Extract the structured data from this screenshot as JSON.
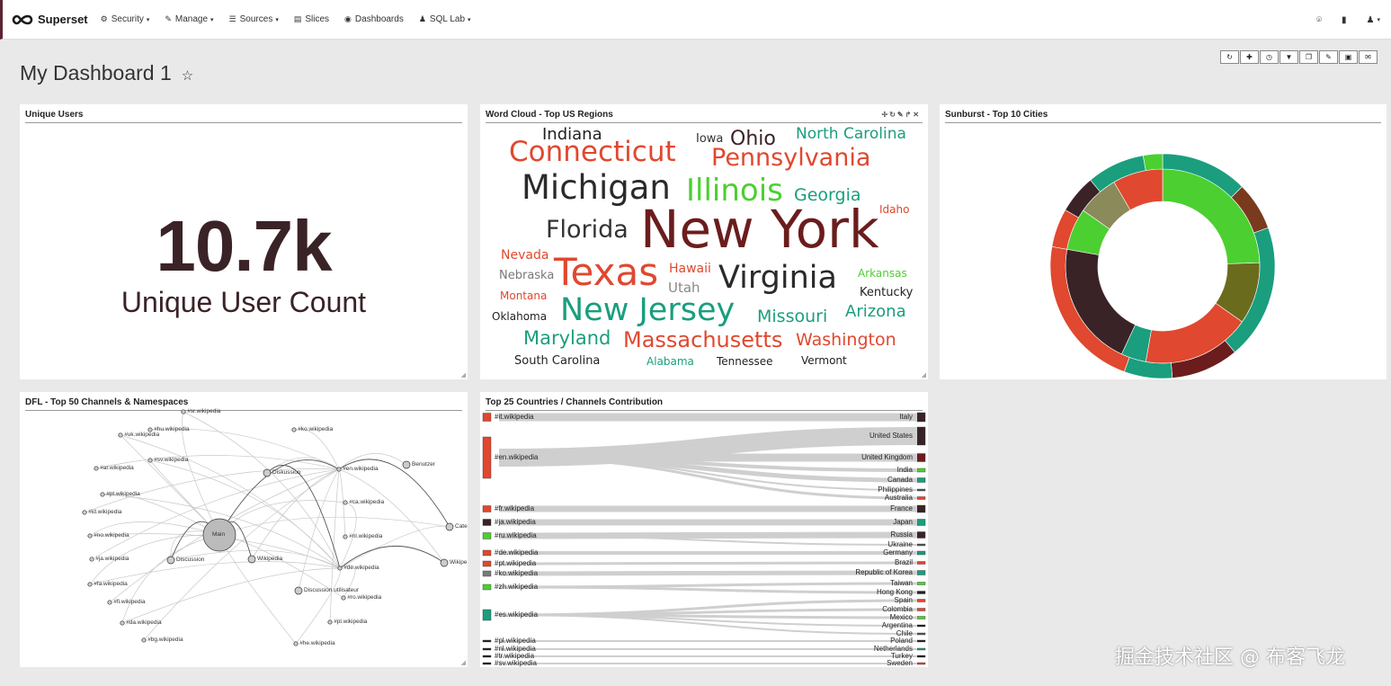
{
  "nav": {
    "brand": "Superset",
    "items": [
      {
        "id": "security",
        "icon": "⚙",
        "icon_name": "cogs-icon",
        "label": "Security",
        "dropdown": true
      },
      {
        "id": "manage",
        "icon": "✎",
        "icon_name": "wrench-icon",
        "label": "Manage",
        "dropdown": true
      },
      {
        "id": "sources",
        "icon": "☰",
        "icon_name": "database-icon",
        "label": "Sources",
        "dropdown": true
      },
      {
        "id": "slices",
        "icon": "▤",
        "icon_name": "bar-chart-icon",
        "label": "Slices",
        "dropdown": false
      },
      {
        "id": "dashboards",
        "icon": "◉",
        "icon_name": "dashboard-icon",
        "label": "Dashboards",
        "dropdown": false
      },
      {
        "id": "sqllab",
        "icon": "♟",
        "icon_name": "flask-icon",
        "label": "SQL Lab",
        "dropdown": true
      }
    ],
    "right_icons": [
      "github-icon",
      "book-icon",
      "user-icon"
    ]
  },
  "dashboard": {
    "title": "My Dashboard 1",
    "controls": [
      "refresh-icon",
      "add-slice-icon",
      "history-icon",
      "filter-icon",
      "css-icon",
      "edit-icon",
      "save-icon",
      "email-icon"
    ]
  },
  "panels": {
    "unique_users": {
      "title": "Unique Users",
      "value": "10.7k",
      "subheader": "Unique User Count"
    },
    "word_cloud": {
      "title": "Word Cloud - Top US Regions",
      "words": [
        {
          "text": "Indiana",
          "color": "#222222"
        },
        {
          "text": "Iowa",
          "color": "#333333"
        },
        {
          "text": "Ohio",
          "color": "#3a2326"
        },
        {
          "text": "North Carolina",
          "color": "#1a9e7e"
        },
        {
          "text": "Connecticut",
          "color": "#e0482f"
        },
        {
          "text": "Pennsylvania",
          "color": "#e0482f"
        },
        {
          "text": "Michigan",
          "color": "#2a2a2a"
        },
        {
          "text": "Illinois",
          "color": "#4ccf31"
        },
        {
          "text": "Georgia",
          "color": "#1a9e7e"
        },
        {
          "text": "Idaho",
          "color": "#e0482f"
        },
        {
          "text": "Florida",
          "color": "#333333"
        },
        {
          "text": "New York",
          "color": "#6b1d1d"
        },
        {
          "text": "Nevada",
          "color": "#e0482f"
        },
        {
          "text": "Texas",
          "color": "#e0482f"
        },
        {
          "text": "Hawaii",
          "color": "#e0482f"
        },
        {
          "text": "Virginia",
          "color": "#2a2a2a"
        },
        {
          "text": "Arkansas",
          "color": "#4ccf31"
        },
        {
          "text": "Nebraska",
          "color": "#777777"
        },
        {
          "text": "Utah",
          "color": "#888888"
        },
        {
          "text": "Kentucky",
          "color": "#222222"
        },
        {
          "text": "Montana",
          "color": "#e0482f"
        },
        {
          "text": "New Jersey",
          "color": "#1a9e7e"
        },
        {
          "text": "Missouri",
          "color": "#1a9e7e"
        },
        {
          "text": "Arizona",
          "color": "#1a9e7e"
        },
        {
          "text": "Oklahoma",
          "color": "#222222"
        },
        {
          "text": "Maryland",
          "color": "#1a9e7e"
        },
        {
          "text": "Massachusetts",
          "color": "#e0482f"
        },
        {
          "text": "Washington",
          "color": "#e0482f"
        },
        {
          "text": "South Carolina",
          "color": "#222222"
        },
        {
          "text": "Alabama",
          "color": "#1a9e7e"
        },
        {
          "text": "Tennessee",
          "color": "#222222"
        },
        {
          "text": "Vermont",
          "color": "#222222"
        }
      ]
    },
    "sunburst": {
      "title": "Sunburst - Top 10 Cities"
    },
    "dfl": {
      "title": "DFL - Top 50 Channels & Namespaces",
      "nodes": [
        "#uk.wikipedia",
        "#hu.wikipedia",
        "#sr.wikipedia",
        "#ko.wikipedia",
        "#sv.wikipedia",
        "#ar.wikipedia",
        "#pt.wikipedia",
        "#id.wikipedia",
        "#no.wikipedia",
        "#ja.wikipedia",
        "#fa.wikipedia",
        "#fi.wikipedia",
        "#da.wikipedia",
        "#bg.wikipedia",
        "Main",
        "Diskussion",
        "#en.wikipedia",
        "Benutzer",
        "#ca.wikipedia",
        "#nl.wikipedia",
        "Discussion",
        "Wikipedia",
        "#de.wikipedia",
        "Discussion utilisateur",
        "#ro.wikipedia",
        "#pl.wikipedia",
        "#he.wikipedia",
        "Wikipe",
        "Cate"
      ]
    },
    "sankey": {
      "title": "Top 25 Countries / Channels Contribution",
      "sources": [
        {
          "label": "#it.wikipedia",
          "color": "#e0482f"
        },
        {
          "label": "#en.wikipedia",
          "color": "#e0482f"
        },
        {
          "label": "#fr.wikipedia",
          "color": "#e0482f"
        },
        {
          "label": "#ja.wikipedia",
          "color": "#3a2326"
        },
        {
          "label": "#ru.wikipedia",
          "color": "#4ccf31"
        },
        {
          "label": "#de.wikipedia",
          "color": "#e0482f"
        },
        {
          "label": "#pt.wikipedia",
          "color": "#e0482f"
        },
        {
          "label": "#ko.wikipedia",
          "color": "#7a7a7a"
        },
        {
          "label": "#zh.wikipedia",
          "color": "#4ccf31"
        },
        {
          "label": "#es.wikipedia",
          "color": "#1a9e7e"
        },
        {
          "label": "#pl.wikipedia",
          "color": "#222222"
        },
        {
          "label": "#nl.wikipedia",
          "color": "#222222"
        },
        {
          "label": "#tr.wikipedia",
          "color": "#222222"
        },
        {
          "label": "#sv.wikipedia",
          "color": "#222222"
        }
      ],
      "targets": [
        {
          "label": "Italy",
          "color": "#3a2326"
        },
        {
          "label": "United States",
          "color": "#3a2326"
        },
        {
          "label": "United Kingdom",
          "color": "#6b1d1d"
        },
        {
          "label": "India",
          "color": "#4ccf31"
        },
        {
          "label": "Canada",
          "color": "#1a9e7e"
        },
        {
          "label": "Philippines",
          "color": "#555555"
        },
        {
          "label": "Australia",
          "color": "#e0482f"
        },
        {
          "label": "France",
          "color": "#3a2326"
        },
        {
          "label": "Japan",
          "color": "#1a9e7e"
        },
        {
          "label": "Russia",
          "color": "#3a2326"
        },
        {
          "label": "Ukraine",
          "color": "#555555"
        },
        {
          "label": "Germany",
          "color": "#1a9e7e"
        },
        {
          "label": "Brazil",
          "color": "#e0482f"
        },
        {
          "label": "Republic of Korea",
          "color": "#1a9e7e"
        },
        {
          "label": "Taiwan",
          "color": "#4ccf31"
        },
        {
          "label": "Hong Kong",
          "color": "#222222"
        },
        {
          "label": "Spain",
          "color": "#e0482f"
        },
        {
          "label": "Colombia",
          "color": "#e0482f"
        },
        {
          "label": "Mexico",
          "color": "#4ccf31"
        },
        {
          "label": "Argentina",
          "color": "#222222"
        },
        {
          "label": "Chile",
          "color": "#555555"
        },
        {
          "label": "Poland",
          "color": "#222222"
        },
        {
          "label": "Netherlands",
          "color": "#1a9e7e"
        },
        {
          "label": "Turkey",
          "color": "#222222"
        },
        {
          "label": "Sweden",
          "color": "#e0482f"
        }
      ]
    }
  },
  "watermark": "掘金技术社区 @ 布客飞龙"
}
